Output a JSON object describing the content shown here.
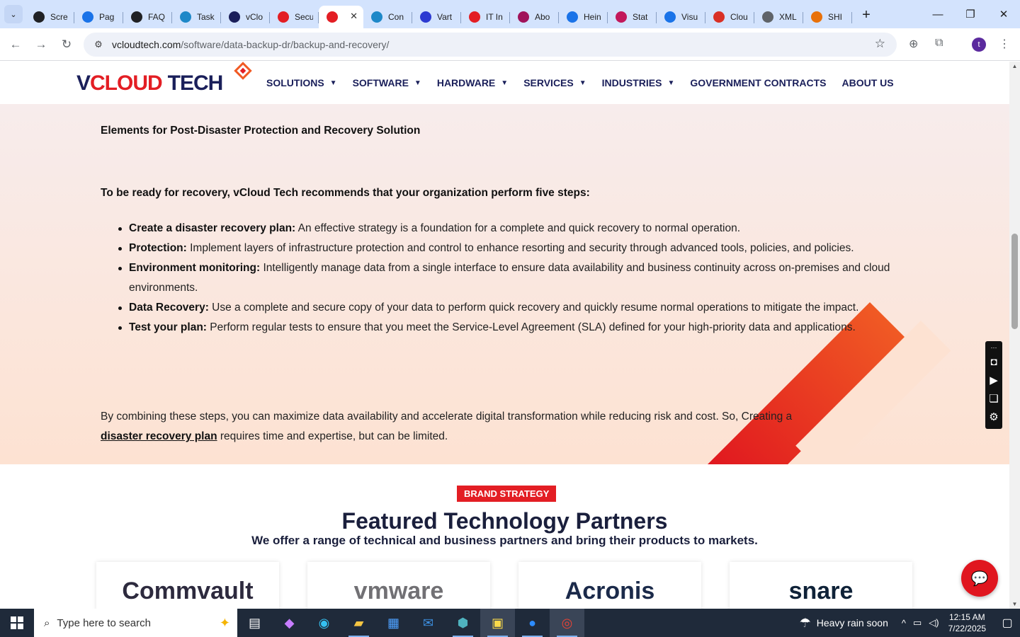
{
  "browser": {
    "tabs": [
      {
        "label": "Scre",
        "icon": "circle-target-icon",
        "color": "#202124"
      },
      {
        "label": "Pag",
        "icon": "speedometer-icon",
        "color": "#1a73e8"
      },
      {
        "label": "FAQ",
        "icon": "openai-icon",
        "color": "#202124"
      },
      {
        "label": "Task",
        "icon": "hexagon-icon",
        "color": "#1e88c8"
      },
      {
        "label": "vClo",
        "icon": "v-logo-icon",
        "color": "#1a1f5a"
      },
      {
        "label": "Secu",
        "icon": "vcloud-diamond-icon",
        "color": "#e31e24"
      },
      {
        "label": "",
        "icon": "vcloud-diamond-icon",
        "color": "#e31e24",
        "active": true
      },
      {
        "label": "Con",
        "icon": "hexagon-icon",
        "color": "#1e88c8"
      },
      {
        "label": "Vart",
        "icon": "x-logo-icon",
        "color": "#2c3ad1"
      },
      {
        "label": "IT In",
        "icon": "vcloud-diamond-icon",
        "color": "#e31e24"
      },
      {
        "label": "Abo",
        "icon": "feather-icon",
        "color": "#a0135a"
      },
      {
        "label": "Hein",
        "icon": "scales-icon",
        "color": "#1a73e8"
      },
      {
        "label": "Stat",
        "icon": "pen-icon",
        "color": "#c2185b"
      },
      {
        "label": "Visu",
        "icon": "pulse-icon",
        "color": "#1a73e8"
      },
      {
        "label": "Clou",
        "icon": "stroke-icon",
        "color": "#d93025"
      },
      {
        "label": "XML",
        "icon": "globe-icon",
        "color": "#5f6368"
      },
      {
        "label": "SHI",
        "icon": "ring-icon",
        "color": "#e8710a"
      }
    ],
    "url_host": "vcloudtech.com",
    "url_path": "/software/data-backup-dr/backup-and-recovery/",
    "avatar_letter": "t"
  },
  "site": {
    "logo_v": "V",
    "logo_cloud": "CLOUD",
    "logo_tech": "TECH",
    "menu": [
      {
        "label": "SOLUTIONS",
        "dropdown": true
      },
      {
        "label": "SOFTWARE",
        "dropdown": true
      },
      {
        "label": "HARDWARE",
        "dropdown": true
      },
      {
        "label": "SERVICES",
        "dropdown": true
      },
      {
        "label": "INDUSTRIES",
        "dropdown": true
      },
      {
        "label": "GOVERNMENT CONTRACTS",
        "dropdown": false
      },
      {
        "label": "ABOUT US",
        "dropdown": false
      }
    ]
  },
  "content": {
    "subheading": "Elements for Post-Disaster Protection and Recovery Solution",
    "intro": "To be ready for recovery, vCloud Tech recommends that your organization perform five steps:",
    "steps": [
      {
        "title": "Create a disaster recovery plan:",
        "text": " An effective strategy is a foundation for a complete and quick recovery to normal operation."
      },
      {
        "title": "Protection:",
        "text": " Implement layers of infrastructure protection and control to enhance resorting and security through advanced tools, policies, and policies."
      },
      {
        "title": "Environment monitoring:",
        "text": " Intelligently manage data from a single interface to ensure data availability and business continuity across on-premises and cloud environments."
      },
      {
        "title": "Data Recovery:",
        "text": " Use a complete and secure copy of your data to perform quick recovery and quickly resume normal operations to mitigate the impact."
      },
      {
        "title": "Test your plan:",
        "text": " Perform regular tests to ensure that you meet the Service-Level Agreement (SLA) defined for your high-priority data and applications."
      }
    ],
    "closing_text": "By combining these steps, you can maximize data availability and accelerate digital transformation while reducing risk and cost. So, Creating a",
    "closing_link": "disaster recovery plan",
    "closing_tail": " requires time and expertise, but can be limited."
  },
  "partners": {
    "badge": "BRAND STRATEGY",
    "title": "Featured Technology Partners",
    "subtitle": "We offer a range of technical and business partners and bring their products to markets.",
    "cards": [
      {
        "name": "Commvault",
        "color": "#2d2a3e"
      },
      {
        "name": "vmware",
        "color": "#717074"
      },
      {
        "name": "Acronis",
        "color": "#1b2a4a"
      },
      {
        "name": "snare",
        "color": "#0f2238"
      }
    ]
  },
  "taskbar": {
    "search_placeholder": "Type here to search",
    "weather": "Heavy rain soon",
    "time": "12:15 AM",
    "date": "7/22/2025"
  }
}
